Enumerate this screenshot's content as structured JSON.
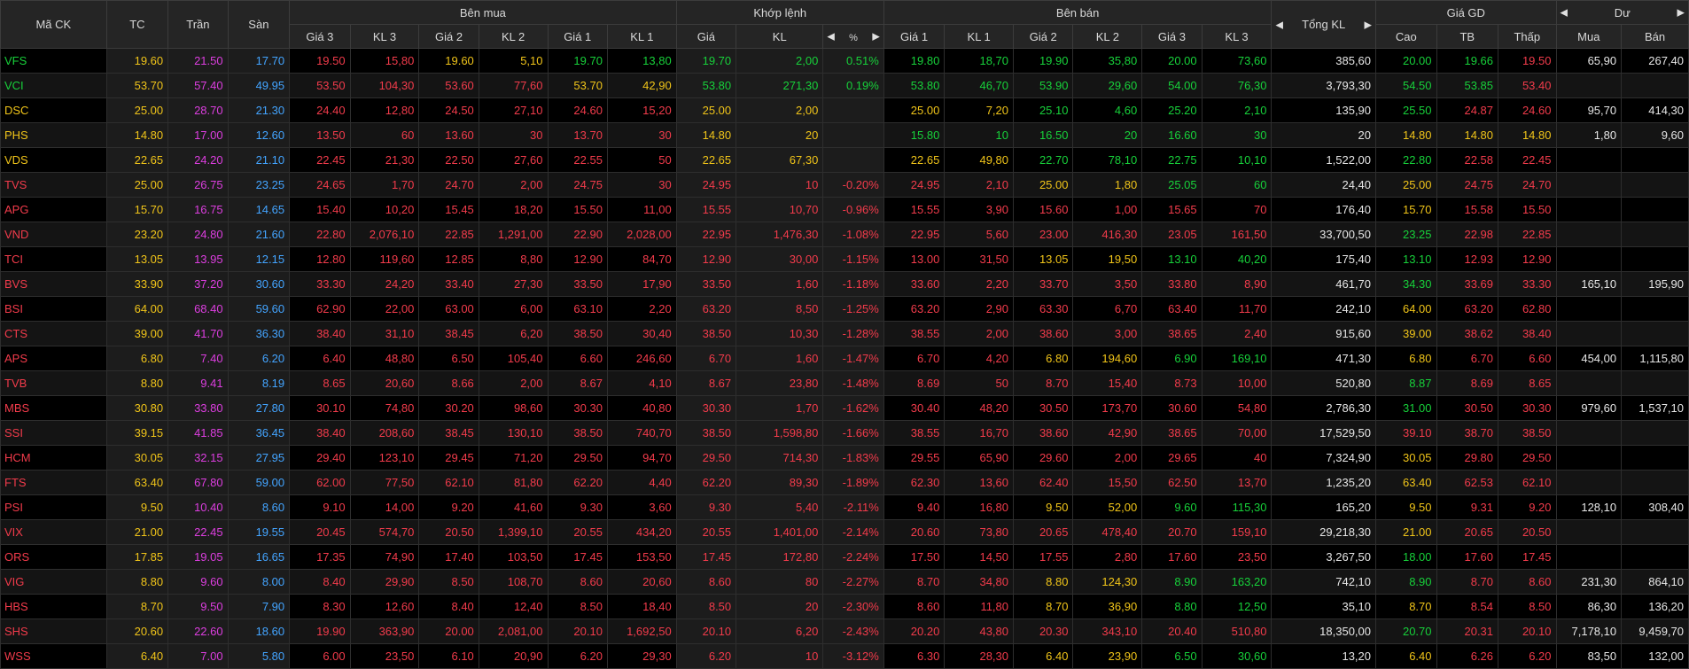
{
  "colors": {
    "up": "#17d13a",
    "down": "#f23b4b",
    "ref": "#f0c419",
    "ceiling": "#dd3ee0",
    "floor": "#43a4ff",
    "text": "#e6e6e6",
    "header_bg": "#252525"
  },
  "icons": {
    "nav_left": "caret-left-icon",
    "nav_right": "caret-right-icon",
    "sort": "sort-icon"
  },
  "header": {
    "symbol": "Mã CK",
    "ref": "TC",
    "ceiling": "Trần",
    "floor": "Sàn",
    "buy_group": "Bên mua",
    "match_group": "Khớp lệnh",
    "sell_group": "Bên bán",
    "total_vol": "Tổng KL",
    "trade_price_group": "Giá GD",
    "remain_group": "Dư",
    "bid3": "Giá 3",
    "bvol3": "KL 3",
    "bid2": "Giá 2",
    "bvol2": "KL 2",
    "bid1": "Giá 1",
    "bvol1": "KL 1",
    "m_price": "Giá",
    "m_vol": "KL",
    "m_pct": "%",
    "ask1": "Giá 1",
    "avol1": "KL 1",
    "ask2": "Giá 2",
    "avol2": "KL 2",
    "ask3": "Giá 3",
    "avol3": "KL 3",
    "high": "Cao",
    "avg": "TB",
    "low": "Thấp",
    "r_buy": "Mua",
    "r_sell": "Bán"
  },
  "rows": [
    {
      "sym": "VFS",
      "symc": "g",
      "tc": "19.60",
      "tr": "21.50",
      "sa": "17.70",
      "b3": "19.50",
      "b3c": "r",
      "v3": "15,80",
      "b2": "19.60",
      "b2c": "y",
      "v2": "5,10",
      "b1": "19.70",
      "b1c": "g",
      "v1": "13,80",
      "mp": "19.70",
      "mc": "g",
      "mv": "2,00",
      "pct": "0.51%",
      "a1": "19.80",
      "a1c": "g",
      "av1": "18,70",
      "a2": "19.90",
      "a2c": "g",
      "av2": "35,80",
      "a3": "20.00",
      "a3c": "g",
      "av3": "73,60",
      "tot": "385,60",
      "hi": "20.00",
      "hic": "g",
      "avg": "19.66",
      "avgc": "g",
      "lo": "19.50",
      "loc": "r",
      "rb": "65,90",
      "rs": "267,40"
    },
    {
      "sym": "VCI",
      "symc": "g",
      "tc": "53.70",
      "tr": "57.40",
      "sa": "49.95",
      "b3": "53.50",
      "b3c": "r",
      "v3": "104,30",
      "b2": "53.60",
      "b2c": "r",
      "v2": "77,60",
      "b1": "53.70",
      "b1c": "y",
      "v1": "42,90",
      "mp": "53.80",
      "mc": "g",
      "mv": "271,30",
      "pct": "0.19%",
      "a1": "53.80",
      "a1c": "g",
      "av1": "46,70",
      "a2": "53.90",
      "a2c": "g",
      "av2": "29,60",
      "a3": "54.00",
      "a3c": "g",
      "av3": "76,30",
      "tot": "3,793,30",
      "hi": "54.50",
      "hic": "g",
      "avg": "53.85",
      "avgc": "g",
      "lo": "53.40",
      "loc": "r",
      "rb": "",
      "rs": ""
    },
    {
      "sym": "DSC",
      "symc": "y",
      "tc": "25.00",
      "tr": "28.70",
      "sa": "21.30",
      "b3": "24.40",
      "b3c": "r",
      "v3": "12,80",
      "b2": "24.50",
      "b2c": "r",
      "v2": "27,10",
      "b1": "24.60",
      "b1c": "r",
      "v1": "15,20",
      "mp": "25.00",
      "mc": "y",
      "mv": "2,00",
      "pct": "",
      "a1": "25.00",
      "a1c": "y",
      "av1": "7,20",
      "a2": "25.10",
      "a2c": "g",
      "av2": "4,60",
      "a3": "25.20",
      "a3c": "g",
      "av3": "2,10",
      "tot": "135,90",
      "hi": "25.50",
      "hic": "g",
      "avg": "24.87",
      "avgc": "r",
      "lo": "24.60",
      "loc": "r",
      "rb": "95,70",
      "rs": "414,30"
    },
    {
      "sym": "PHS",
      "symc": "y",
      "tc": "14.80",
      "tr": "17.00",
      "sa": "12.60",
      "b3": "13.50",
      "b3c": "r",
      "v3": "60",
      "b2": "13.60",
      "b2c": "r",
      "v2": "30",
      "b1": "13.70",
      "b1c": "r",
      "v1": "30",
      "mp": "14.80",
      "mc": "y",
      "mv": "20",
      "pct": "",
      "a1": "15.80",
      "a1c": "g",
      "av1": "10",
      "a2": "16.50",
      "a2c": "g",
      "av2": "20",
      "a3": "16.60",
      "a3c": "g",
      "av3": "30",
      "tot": "20",
      "hi": "14.80",
      "hic": "y",
      "avg": "14.80",
      "avgc": "y",
      "lo": "14.80",
      "loc": "y",
      "rb": "1,80",
      "rs": "9,60"
    },
    {
      "sym": "VDS",
      "symc": "y",
      "tc": "22.65",
      "tr": "24.20",
      "sa": "21.10",
      "b3": "22.45",
      "b3c": "r",
      "v3": "21,30",
      "b2": "22.50",
      "b2c": "r",
      "v2": "27,60",
      "b1": "22.55",
      "b1c": "r",
      "v1": "50",
      "mp": "22.65",
      "mc": "y",
      "mv": "67,30",
      "pct": "",
      "a1": "22.65",
      "a1c": "y",
      "av1": "49,80",
      "a2": "22.70",
      "a2c": "g",
      "av2": "78,10",
      "a3": "22.75",
      "a3c": "g",
      "av3": "10,10",
      "tot": "1,522,00",
      "hi": "22.80",
      "hic": "g",
      "avg": "22.58",
      "avgc": "r",
      "lo": "22.45",
      "loc": "r",
      "rb": "",
      "rs": ""
    },
    {
      "sym": "TVS",
      "symc": "r",
      "tc": "25.00",
      "tr": "26.75",
      "sa": "23.25",
      "b3": "24.65",
      "b3c": "r",
      "v3": "1,70",
      "b2": "24.70",
      "b2c": "r",
      "v2": "2,00",
      "b1": "24.75",
      "b1c": "r",
      "v1": "30",
      "mp": "24.95",
      "mc": "r",
      "mv": "10",
      "pct": "-0.20%",
      "a1": "24.95",
      "a1c": "r",
      "av1": "2,10",
      "a2": "25.00",
      "a2c": "y",
      "av2": "1,80",
      "a3": "25.05",
      "a3c": "g",
      "av3": "60",
      "tot": "24,40",
      "hi": "25.00",
      "hic": "y",
      "avg": "24.75",
      "avgc": "r",
      "lo": "24.70",
      "loc": "r",
      "rb": "",
      "rs": ""
    },
    {
      "sym": "APG",
      "symc": "r",
      "tc": "15.70",
      "tr": "16.75",
      "sa": "14.65",
      "b3": "15.40",
      "b3c": "r",
      "v3": "10,20",
      "b2": "15.45",
      "b2c": "r",
      "v2": "18,20",
      "b1": "15.50",
      "b1c": "r",
      "v1": "11,00",
      "mp": "15.55",
      "mc": "r",
      "mv": "10,70",
      "pct": "-0.96%",
      "a1": "15.55",
      "a1c": "r",
      "av1": "3,90",
      "a2": "15.60",
      "a2c": "r",
      "av2": "1,00",
      "a3": "15.65",
      "a3c": "r",
      "av3": "70",
      "tot": "176,40",
      "hi": "15.70",
      "hic": "y",
      "avg": "15.58",
      "avgc": "r",
      "lo": "15.50",
      "loc": "r",
      "rb": "",
      "rs": ""
    },
    {
      "sym": "VND",
      "symc": "r",
      "tc": "23.20",
      "tr": "24.80",
      "sa": "21.60",
      "b3": "22.80",
      "b3c": "r",
      "v3": "2,076,10",
      "b2": "22.85",
      "b2c": "r",
      "v2": "1,291,00",
      "b1": "22.90",
      "b1c": "r",
      "v1": "2,028,00",
      "mp": "22.95",
      "mc": "r",
      "mv": "1,476,30",
      "pct": "-1.08%",
      "a1": "22.95",
      "a1c": "r",
      "av1": "5,60",
      "a2": "23.00",
      "a2c": "r",
      "av2": "416,30",
      "a3": "23.05",
      "a3c": "r",
      "av3": "161,50",
      "tot": "33,700,50",
      "hi": "23.25",
      "hic": "g",
      "avg": "22.98",
      "avgc": "r",
      "lo": "22.85",
      "loc": "r",
      "rb": "",
      "rs": ""
    },
    {
      "sym": "TCI",
      "symc": "r",
      "tc": "13.05",
      "tr": "13.95",
      "sa": "12.15",
      "b3": "12.80",
      "b3c": "r",
      "v3": "119,60",
      "b2": "12.85",
      "b2c": "r",
      "v2": "8,80",
      "b1": "12.90",
      "b1c": "r",
      "v1": "84,70",
      "mp": "12.90",
      "mc": "r",
      "mv": "30,00",
      "pct": "-1.15%",
      "a1": "13.00",
      "a1c": "r",
      "av1": "31,50",
      "a2": "13.05",
      "a2c": "y",
      "av2": "19,50",
      "a3": "13.10",
      "a3c": "g",
      "av3": "40,20",
      "tot": "175,40",
      "hi": "13.10",
      "hic": "g",
      "avg": "12.93",
      "avgc": "r",
      "lo": "12.90",
      "loc": "r",
      "rb": "",
      "rs": ""
    },
    {
      "sym": "BVS",
      "symc": "r",
      "tc": "33.90",
      "tr": "37.20",
      "sa": "30.60",
      "b3": "33.30",
      "b3c": "r",
      "v3": "24,20",
      "b2": "33.40",
      "b2c": "r",
      "v2": "27,30",
      "b1": "33.50",
      "b1c": "r",
      "v1": "17,90",
      "mp": "33.50",
      "mc": "r",
      "mv": "1,60",
      "pct": "-1.18%",
      "a1": "33.60",
      "a1c": "r",
      "av1": "2,20",
      "a2": "33.70",
      "a2c": "r",
      "av2": "3,50",
      "a3": "33.80",
      "a3c": "r",
      "av3": "8,90",
      "tot": "461,70",
      "hi": "34.30",
      "hic": "g",
      "avg": "33.69",
      "avgc": "r",
      "lo": "33.30",
      "loc": "r",
      "rb": "165,10",
      "rs": "195,90"
    },
    {
      "sym": "BSI",
      "symc": "r",
      "tc": "64.00",
      "tr": "68.40",
      "sa": "59.60",
      "b3": "62.90",
      "b3c": "r",
      "v3": "22,00",
      "b2": "63.00",
      "b2c": "r",
      "v2": "6,00",
      "b1": "63.10",
      "b1c": "r",
      "v1": "2,20",
      "mp": "63.20",
      "mc": "r",
      "mv": "8,50",
      "pct": "-1.25%",
      "a1": "63.20",
      "a1c": "r",
      "av1": "2,90",
      "a2": "63.30",
      "a2c": "r",
      "av2": "6,70",
      "a3": "63.40",
      "a3c": "r",
      "av3": "11,70",
      "tot": "242,10",
      "hi": "64.00",
      "hic": "y",
      "avg": "63.20",
      "avgc": "r",
      "lo": "62.80",
      "loc": "r",
      "rb": "",
      "rs": ""
    },
    {
      "sym": "CTS",
      "symc": "r",
      "tc": "39.00",
      "tr": "41.70",
      "sa": "36.30",
      "b3": "38.40",
      "b3c": "r",
      "v3": "31,10",
      "b2": "38.45",
      "b2c": "r",
      "v2": "6,20",
      "b1": "38.50",
      "b1c": "r",
      "v1": "30,40",
      "mp": "38.50",
      "mc": "r",
      "mv": "10,30",
      "pct": "-1.28%",
      "a1": "38.55",
      "a1c": "r",
      "av1": "2,00",
      "a2": "38.60",
      "a2c": "r",
      "av2": "3,00",
      "a3": "38.65",
      "a3c": "r",
      "av3": "2,40",
      "tot": "915,60",
      "hi": "39.00",
      "hic": "y",
      "avg": "38.62",
      "avgc": "r",
      "lo": "38.40",
      "loc": "r",
      "rb": "",
      "rs": ""
    },
    {
      "sym": "APS",
      "symc": "r",
      "tc": "6.80",
      "tr": "7.40",
      "sa": "6.20",
      "b3": "6.40",
      "b3c": "r",
      "v3": "48,80",
      "b2": "6.50",
      "b2c": "r",
      "v2": "105,40",
      "b1": "6.60",
      "b1c": "r",
      "v1": "246,60",
      "mp": "6.70",
      "mc": "r",
      "mv": "1,60",
      "pct": "-1.47%",
      "a1": "6.70",
      "a1c": "r",
      "av1": "4,20",
      "a2": "6.80",
      "a2c": "y",
      "av2": "194,60",
      "a3": "6.90",
      "a3c": "g",
      "av3": "169,10",
      "tot": "471,30",
      "hi": "6.80",
      "hic": "y",
      "avg": "6.70",
      "avgc": "r",
      "lo": "6.60",
      "loc": "r",
      "rb": "454,00",
      "rs": "1,115,80"
    },
    {
      "sym": "TVB",
      "symc": "r",
      "tc": "8.80",
      "tr": "9.41",
      "sa": "8.19",
      "b3": "8.65",
      "b3c": "r",
      "v3": "20,60",
      "b2": "8.66",
      "b2c": "r",
      "v2": "2,00",
      "b1": "8.67",
      "b1c": "r",
      "v1": "4,10",
      "mp": "8.67",
      "mc": "r",
      "mv": "23,80",
      "pct": "-1.48%",
      "a1": "8.69",
      "a1c": "r",
      "av1": "50",
      "a2": "8.70",
      "a2c": "r",
      "av2": "15,40",
      "a3": "8.73",
      "a3c": "r",
      "av3": "10,00",
      "tot": "520,80",
      "hi": "8.87",
      "hic": "g",
      "avg": "8.69",
      "avgc": "r",
      "lo": "8.65",
      "loc": "r",
      "rb": "",
      "rs": ""
    },
    {
      "sym": "MBS",
      "symc": "r",
      "tc": "30.80",
      "tr": "33.80",
      "sa": "27.80",
      "b3": "30.10",
      "b3c": "r",
      "v3": "74,80",
      "b2": "30.20",
      "b2c": "r",
      "v2": "98,60",
      "b1": "30.30",
      "b1c": "r",
      "v1": "40,80",
      "mp": "30.30",
      "mc": "r",
      "mv": "1,70",
      "pct": "-1.62%",
      "a1": "30.40",
      "a1c": "r",
      "av1": "48,20",
      "a2": "30.50",
      "a2c": "r",
      "av2": "173,70",
      "a3": "30.60",
      "a3c": "r",
      "av3": "54,80",
      "tot": "2,786,30",
      "hi": "31.00",
      "hic": "g",
      "avg": "30.50",
      "avgc": "r",
      "lo": "30.30",
      "loc": "r",
      "rb": "979,60",
      "rs": "1,537,10"
    },
    {
      "sym": "SSI",
      "symc": "r",
      "tc": "39.15",
      "tr": "41.85",
      "sa": "36.45",
      "b3": "38.40",
      "b3c": "r",
      "v3": "208,60",
      "b2": "38.45",
      "b2c": "r",
      "v2": "130,10",
      "b1": "38.50",
      "b1c": "r",
      "v1": "740,70",
      "mp": "38.50",
      "mc": "r",
      "mv": "1,598,80",
      "pct": "-1.66%",
      "a1": "38.55",
      "a1c": "r",
      "av1": "16,70",
      "a2": "38.60",
      "a2c": "r",
      "av2": "42,90",
      "a3": "38.65",
      "a3c": "r",
      "av3": "70,00",
      "tot": "17,529,50",
      "hi": "39.10",
      "hic": "r",
      "avg": "38.70",
      "avgc": "r",
      "lo": "38.50",
      "loc": "r",
      "rb": "",
      "rs": ""
    },
    {
      "sym": "HCM",
      "symc": "r",
      "tc": "30.05",
      "tr": "32.15",
      "sa": "27.95",
      "b3": "29.40",
      "b3c": "r",
      "v3": "123,10",
      "b2": "29.45",
      "b2c": "r",
      "v2": "71,20",
      "b1": "29.50",
      "b1c": "r",
      "v1": "94,70",
      "mp": "29.50",
      "mc": "r",
      "mv": "714,30",
      "pct": "-1.83%",
      "a1": "29.55",
      "a1c": "r",
      "av1": "65,90",
      "a2": "29.60",
      "a2c": "r",
      "av2": "2,00",
      "a3": "29.65",
      "a3c": "r",
      "av3": "40",
      "tot": "7,324,90",
      "hi": "30.05",
      "hic": "y",
      "avg": "29.80",
      "avgc": "r",
      "lo": "29.50",
      "loc": "r",
      "rb": "",
      "rs": ""
    },
    {
      "sym": "FTS",
      "symc": "r",
      "tc": "63.40",
      "tr": "67.80",
      "sa": "59.00",
      "b3": "62.00",
      "b3c": "r",
      "v3": "77,50",
      "b2": "62.10",
      "b2c": "r",
      "v2": "81,80",
      "b1": "62.20",
      "b1c": "r",
      "v1": "4,40",
      "mp": "62.20",
      "mc": "r",
      "mv": "89,30",
      "pct": "-1.89%",
      "a1": "62.30",
      "a1c": "r",
      "av1": "13,60",
      "a2": "62.40",
      "a2c": "r",
      "av2": "15,50",
      "a3": "62.50",
      "a3c": "r",
      "av3": "13,70",
      "tot": "1,235,20",
      "hi": "63.40",
      "hic": "y",
      "avg": "62.53",
      "avgc": "r",
      "lo": "62.10",
      "loc": "r",
      "rb": "",
      "rs": ""
    },
    {
      "sym": "PSI",
      "symc": "r",
      "tc": "9.50",
      "tr": "10.40",
      "sa": "8.60",
      "b3": "9.10",
      "b3c": "r",
      "v3": "14,00",
      "b2": "9.20",
      "b2c": "r",
      "v2": "41,60",
      "b1": "9.30",
      "b1c": "r",
      "v1": "3,60",
      "mp": "9.30",
      "mc": "r",
      "mv": "5,40",
      "pct": "-2.11%",
      "a1": "9.40",
      "a1c": "r",
      "av1": "16,80",
      "a2": "9.50",
      "a2c": "y",
      "av2": "52,00",
      "a3": "9.60",
      "a3c": "g",
      "av3": "115,30",
      "tot": "165,20",
      "hi": "9.50",
      "hic": "y",
      "avg": "9.31",
      "avgc": "r",
      "lo": "9.20",
      "loc": "r",
      "rb": "128,10",
      "rs": "308,40"
    },
    {
      "sym": "VIX",
      "symc": "r",
      "tc": "21.00",
      "tr": "22.45",
      "sa": "19.55",
      "b3": "20.45",
      "b3c": "r",
      "v3": "574,70",
      "b2": "20.50",
      "b2c": "r",
      "v2": "1,399,10",
      "b1": "20.55",
      "b1c": "r",
      "v1": "434,20",
      "mp": "20.55",
      "mc": "r",
      "mv": "1,401,00",
      "pct": "-2.14%",
      "a1": "20.60",
      "a1c": "r",
      "av1": "73,80",
      "a2": "20.65",
      "a2c": "r",
      "av2": "478,40",
      "a3": "20.70",
      "a3c": "r",
      "av3": "159,10",
      "tot": "29,218,30",
      "hi": "21.00",
      "hic": "y",
      "avg": "20.65",
      "avgc": "r",
      "lo": "20.50",
      "loc": "r",
      "rb": "",
      "rs": ""
    },
    {
      "sym": "ORS",
      "symc": "r",
      "tc": "17.85",
      "tr": "19.05",
      "sa": "16.65",
      "b3": "17.35",
      "b3c": "r",
      "v3": "74,90",
      "b2": "17.40",
      "b2c": "r",
      "v2": "103,50",
      "b1": "17.45",
      "b1c": "r",
      "v1": "153,50",
      "mp": "17.45",
      "mc": "r",
      "mv": "172,80",
      "pct": "-2.24%",
      "a1": "17.50",
      "a1c": "r",
      "av1": "14,50",
      "a2": "17.55",
      "a2c": "r",
      "av2": "2,80",
      "a3": "17.60",
      "a3c": "r",
      "av3": "23,50",
      "tot": "3,267,50",
      "hi": "18.00",
      "hic": "g",
      "avg": "17.60",
      "avgc": "r",
      "lo": "17.45",
      "loc": "r",
      "rb": "",
      "rs": ""
    },
    {
      "sym": "VIG",
      "symc": "r",
      "tc": "8.80",
      "tr": "9.60",
      "sa": "8.00",
      "b3": "8.40",
      "b3c": "r",
      "v3": "29,90",
      "b2": "8.50",
      "b2c": "r",
      "v2": "108,70",
      "b1": "8.60",
      "b1c": "r",
      "v1": "20,60",
      "mp": "8.60",
      "mc": "r",
      "mv": "80",
      "pct": "-2.27%",
      "a1": "8.70",
      "a1c": "r",
      "av1": "34,80",
      "a2": "8.80",
      "a2c": "y",
      "av2": "124,30",
      "a3": "8.90",
      "a3c": "g",
      "av3": "163,20",
      "tot": "742,10",
      "hi": "8.90",
      "hic": "g",
      "avg": "8.70",
      "avgc": "r",
      "lo": "8.60",
      "loc": "r",
      "rb": "231,30",
      "rs": "864,10"
    },
    {
      "sym": "HBS",
      "symc": "r",
      "tc": "8.70",
      "tr": "9.50",
      "sa": "7.90",
      "b3": "8.30",
      "b3c": "r",
      "v3": "12,60",
      "b2": "8.40",
      "b2c": "r",
      "v2": "12,40",
      "b1": "8.50",
      "b1c": "r",
      "v1": "18,40",
      "mp": "8.50",
      "mc": "r",
      "mv": "20",
      "pct": "-2.30%",
      "a1": "8.60",
      "a1c": "r",
      "av1": "11,80",
      "a2": "8.70",
      "a2c": "y",
      "av2": "36,90",
      "a3": "8.80",
      "a3c": "g",
      "av3": "12,50",
      "tot": "35,10",
      "hi": "8.70",
      "hic": "y",
      "avg": "8.54",
      "avgc": "r",
      "lo": "8.50",
      "loc": "r",
      "rb": "86,30",
      "rs": "136,20"
    },
    {
      "sym": "SHS",
      "symc": "r",
      "tc": "20.60",
      "tr": "22.60",
      "sa": "18.60",
      "b3": "19.90",
      "b3c": "r",
      "v3": "363,90",
      "b2": "20.00",
      "b2c": "r",
      "v2": "2,081,00",
      "b1": "20.10",
      "b1c": "r",
      "v1": "1,692,50",
      "mp": "20.10",
      "mc": "r",
      "mv": "6,20",
      "pct": "-2.43%",
      "a1": "20.20",
      "a1c": "r",
      "av1": "43,80",
      "a2": "20.30",
      "a2c": "r",
      "av2": "343,10",
      "a3": "20.40",
      "a3c": "r",
      "av3": "510,80",
      "tot": "18,350,00",
      "hi": "20.70",
      "hic": "g",
      "avg": "20.31",
      "avgc": "r",
      "lo": "20.10",
      "loc": "r",
      "rb": "7,178,10",
      "rs": "9,459,70"
    },
    {
      "sym": "WSS",
      "symc": "r",
      "tc": "6.40",
      "tr": "7.00",
      "sa": "5.80",
      "b3": "6.00",
      "b3c": "r",
      "v3": "23,50",
      "b2": "6.10",
      "b2c": "r",
      "v2": "20,90",
      "b1": "6.20",
      "b1c": "r",
      "v1": "29,30",
      "mp": "6.20",
      "mc": "r",
      "mv": "10",
      "pct": "-3.12%",
      "a1": "6.30",
      "a1c": "r",
      "av1": "28,30",
      "a2": "6.40",
      "a2c": "y",
      "av2": "23,90",
      "a3": "6.50",
      "a3c": "g",
      "av3": "30,60",
      "tot": "13,20",
      "hi": "6.40",
      "hic": "y",
      "avg": "6.26",
      "avgc": "r",
      "lo": "6.20",
      "loc": "r",
      "rb": "83,50",
      "rs": "132,00"
    }
  ]
}
